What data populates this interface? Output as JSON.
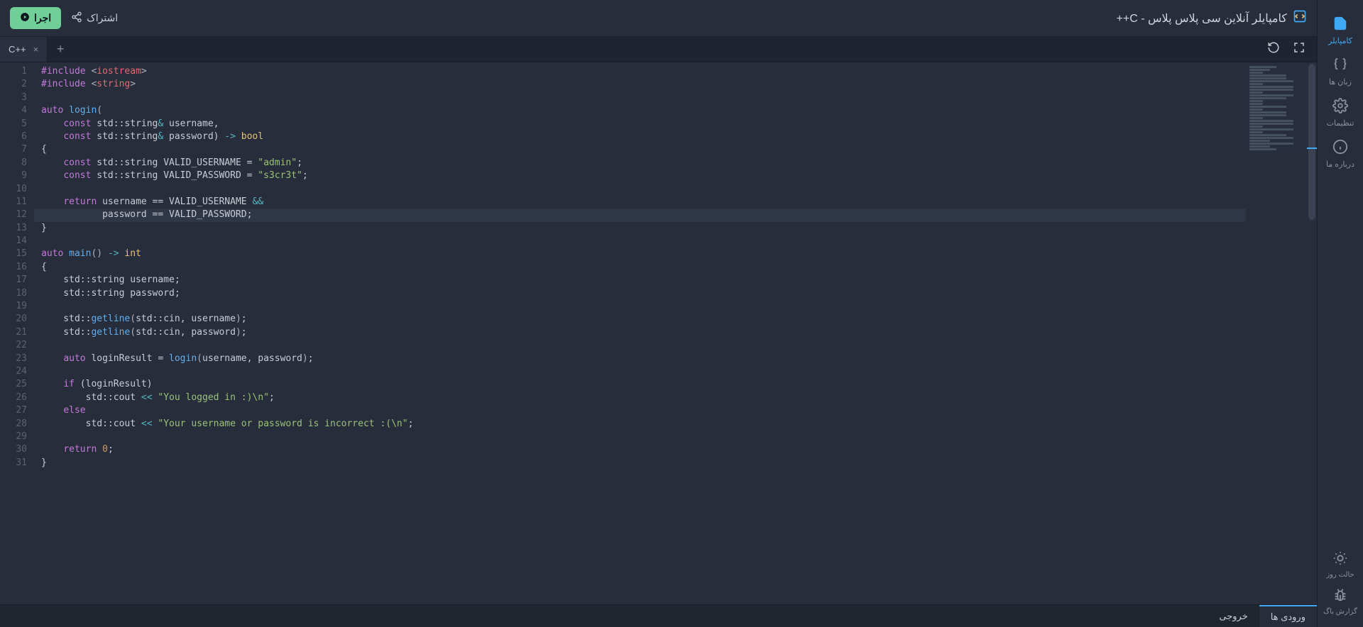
{
  "header": {
    "title": "کامپایلر آنلاین سی پلاس پلاس - C++",
    "share_label": "اشتراک",
    "run_label": "اجرا"
  },
  "sidebar": {
    "items": [
      {
        "label": "کامپایلر",
        "icon": "code-file-icon",
        "active": true
      },
      {
        "label": "زبان ها",
        "icon": "braces-icon",
        "active": false
      },
      {
        "label": "تنظیمات",
        "icon": "gear-icon",
        "active": false
      },
      {
        "label": "درباره ما",
        "icon": "info-icon",
        "active": false
      }
    ],
    "bottom": [
      {
        "label": "حالت روز",
        "icon": "sun-icon"
      },
      {
        "label": "گزارش باگ",
        "icon": "bug-icon"
      }
    ]
  },
  "tabs": {
    "items": [
      {
        "label": "C++"
      }
    ]
  },
  "bottom_tabs": {
    "items": [
      {
        "label": "ورودی ها",
        "active": true
      },
      {
        "label": "خروجی",
        "active": false
      }
    ]
  },
  "editor": {
    "line_count": 31,
    "highlighted_line": 12,
    "lines": [
      {
        "tokens": [
          [
            "k-preproc",
            "#include"
          ],
          [
            "k-punct",
            " <"
          ],
          [
            "k-ident",
            "iostream"
          ],
          [
            "k-punct",
            ">"
          ]
        ]
      },
      {
        "tokens": [
          [
            "k-preproc",
            "#include"
          ],
          [
            "k-punct",
            " <"
          ],
          [
            "k-ident",
            "string"
          ],
          [
            "k-punct",
            ">"
          ]
        ]
      },
      {
        "tokens": []
      },
      {
        "tokens": [
          [
            "k-keyword",
            "auto"
          ],
          [
            "",
            " "
          ],
          [
            "k-func",
            "login"
          ],
          [
            "k-punct",
            "("
          ]
        ]
      },
      {
        "tokens": [
          [
            "",
            "    "
          ],
          [
            "k-keyword",
            "const"
          ],
          [
            "",
            " std::string"
          ],
          [
            "k-op",
            "&"
          ],
          [
            "",
            " username,"
          ]
        ]
      },
      {
        "tokens": [
          [
            "",
            "    "
          ],
          [
            "k-keyword",
            "const"
          ],
          [
            "",
            " std::string"
          ],
          [
            "k-op",
            "&"
          ],
          [
            "",
            " password) "
          ],
          [
            "k-op",
            "->"
          ],
          [
            "",
            " "
          ],
          [
            "k-type",
            "bool"
          ]
        ]
      },
      {
        "tokens": [
          [
            "",
            "{"
          ]
        ]
      },
      {
        "tokens": [
          [
            "",
            "    "
          ],
          [
            "k-keyword",
            "const"
          ],
          [
            "",
            " std::string VALID_USERNAME = "
          ],
          [
            "k-str",
            "\"admin\""
          ],
          [
            "",
            ";"
          ]
        ]
      },
      {
        "tokens": [
          [
            "",
            "    "
          ],
          [
            "k-keyword",
            "const"
          ],
          [
            "",
            " std::string VALID_PASSWORD = "
          ],
          [
            "k-str",
            "\"s3cr3t\""
          ],
          [
            "",
            ";"
          ]
        ]
      },
      {
        "tokens": []
      },
      {
        "tokens": [
          [
            "",
            "    "
          ],
          [
            "k-keyword",
            "return"
          ],
          [
            "",
            " username == VALID_USERNAME "
          ],
          [
            "k-op",
            "&&"
          ]
        ]
      },
      {
        "tokens": [
          [
            "",
            "           password == VALID_PASSWORD;"
          ]
        ]
      },
      {
        "tokens": [
          [
            "",
            "}"
          ]
        ]
      },
      {
        "tokens": []
      },
      {
        "tokens": [
          [
            "k-keyword",
            "auto"
          ],
          [
            "",
            " "
          ],
          [
            "k-func",
            "main"
          ],
          [
            "k-punct",
            "()"
          ],
          [
            "",
            " "
          ],
          [
            "k-op",
            "->"
          ],
          [
            "",
            " "
          ],
          [
            "k-type",
            "int"
          ]
        ]
      },
      {
        "tokens": [
          [
            "",
            "{"
          ]
        ]
      },
      {
        "tokens": [
          [
            "",
            "    std::string username;"
          ]
        ]
      },
      {
        "tokens": [
          [
            "",
            "    std::string password;"
          ]
        ]
      },
      {
        "tokens": []
      },
      {
        "tokens": [
          [
            "",
            "    std::"
          ],
          [
            "k-func",
            "getline"
          ],
          [
            "k-punct",
            "("
          ],
          [
            "",
            "std::cin, username"
          ],
          [
            "k-punct",
            ")"
          ],
          [
            "",
            ";"
          ]
        ]
      },
      {
        "tokens": [
          [
            "",
            "    std::"
          ],
          [
            "k-func",
            "getline"
          ],
          [
            "k-punct",
            "("
          ],
          [
            "",
            "std::cin, password"
          ],
          [
            "k-punct",
            ")"
          ],
          [
            "",
            ";"
          ]
        ]
      },
      {
        "tokens": []
      },
      {
        "tokens": [
          [
            "",
            "    "
          ],
          [
            "k-keyword",
            "auto"
          ],
          [
            "",
            " loginResult = "
          ],
          [
            "k-func",
            "login"
          ],
          [
            "k-punct",
            "("
          ],
          [
            "",
            "username, password"
          ],
          [
            "k-punct",
            ")"
          ],
          [
            "",
            ";"
          ]
        ]
      },
      {
        "tokens": []
      },
      {
        "tokens": [
          [
            "",
            "    "
          ],
          [
            "k-keyword",
            "if"
          ],
          [
            "",
            " (loginResult)"
          ]
        ]
      },
      {
        "tokens": [
          [
            "",
            "        std::cout "
          ],
          [
            "k-op",
            "<<"
          ],
          [
            "",
            " "
          ],
          [
            "k-str",
            "\"You logged in :)\\n\""
          ],
          [
            "",
            ";"
          ]
        ]
      },
      {
        "tokens": [
          [
            "",
            "    "
          ],
          [
            "k-keyword",
            "else"
          ]
        ]
      },
      {
        "tokens": [
          [
            "",
            "        std::cout "
          ],
          [
            "k-op",
            "<<"
          ],
          [
            "",
            " "
          ],
          [
            "k-str",
            "\"Your username or password is incorrect :(\\n\""
          ],
          [
            "",
            ";"
          ]
        ]
      },
      {
        "tokens": []
      },
      {
        "tokens": [
          [
            "",
            "    "
          ],
          [
            "k-keyword",
            "return"
          ],
          [
            "",
            " "
          ],
          [
            "k-num",
            "0"
          ],
          [
            "",
            ";"
          ]
        ]
      },
      {
        "tokens": [
          [
            "",
            "}"
          ]
        ]
      }
    ]
  }
}
